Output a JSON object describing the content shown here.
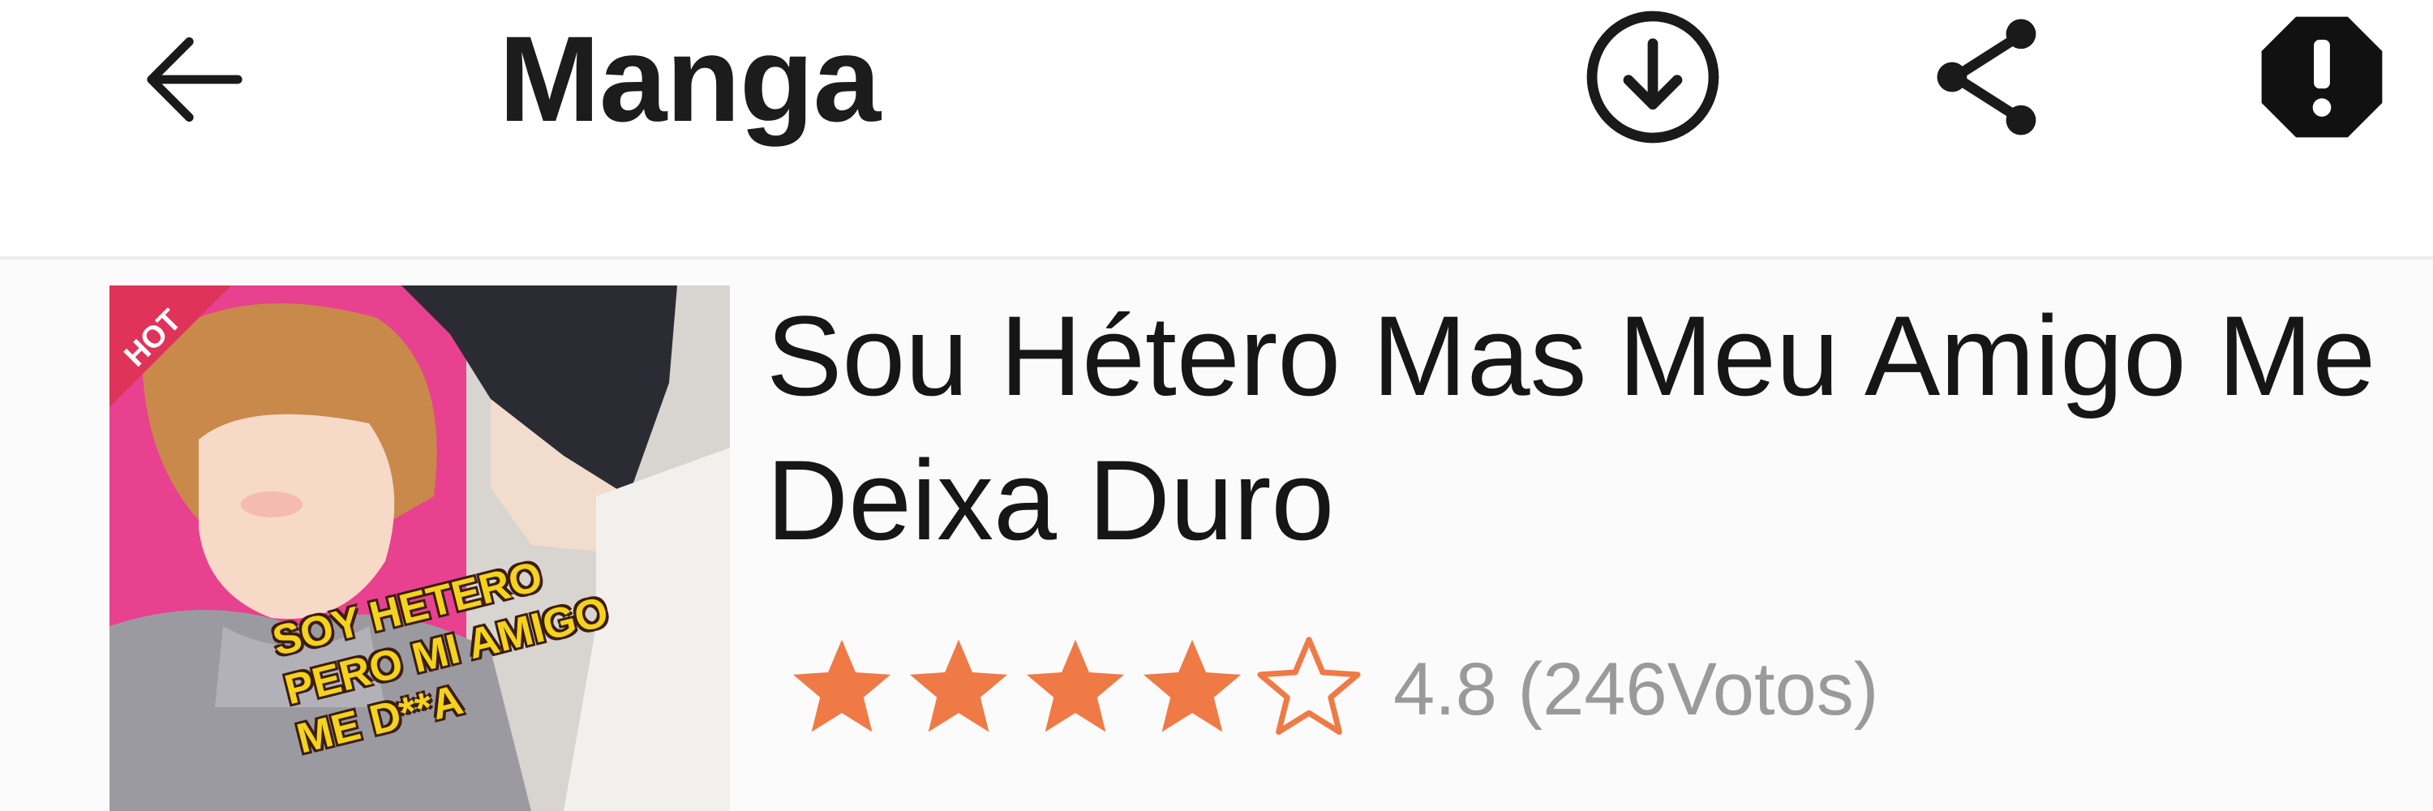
{
  "app_bar": {
    "title": "Manga",
    "icons": {
      "back": "arrow-left-icon",
      "download": "download-circle-icon",
      "share": "share-icon",
      "report": "report-octagon-icon"
    }
  },
  "manga": {
    "title": "Sou Hétero Mas Meu Amigo Me Deixa Duro",
    "cover": {
      "badge": "HOT",
      "cover_lines": [
        "SOY HETERO",
        "PERO MI AMIGO",
        "ME D**A"
      ]
    },
    "rating": {
      "stars_filled": 4,
      "stars_total": 5,
      "value": "4.8",
      "votes": "(246Votos)"
    }
  },
  "colors": {
    "star": "#ef7a45",
    "rating_text": "#9a9a9a",
    "title": "#161616",
    "cover_pink": "#e8418f"
  }
}
